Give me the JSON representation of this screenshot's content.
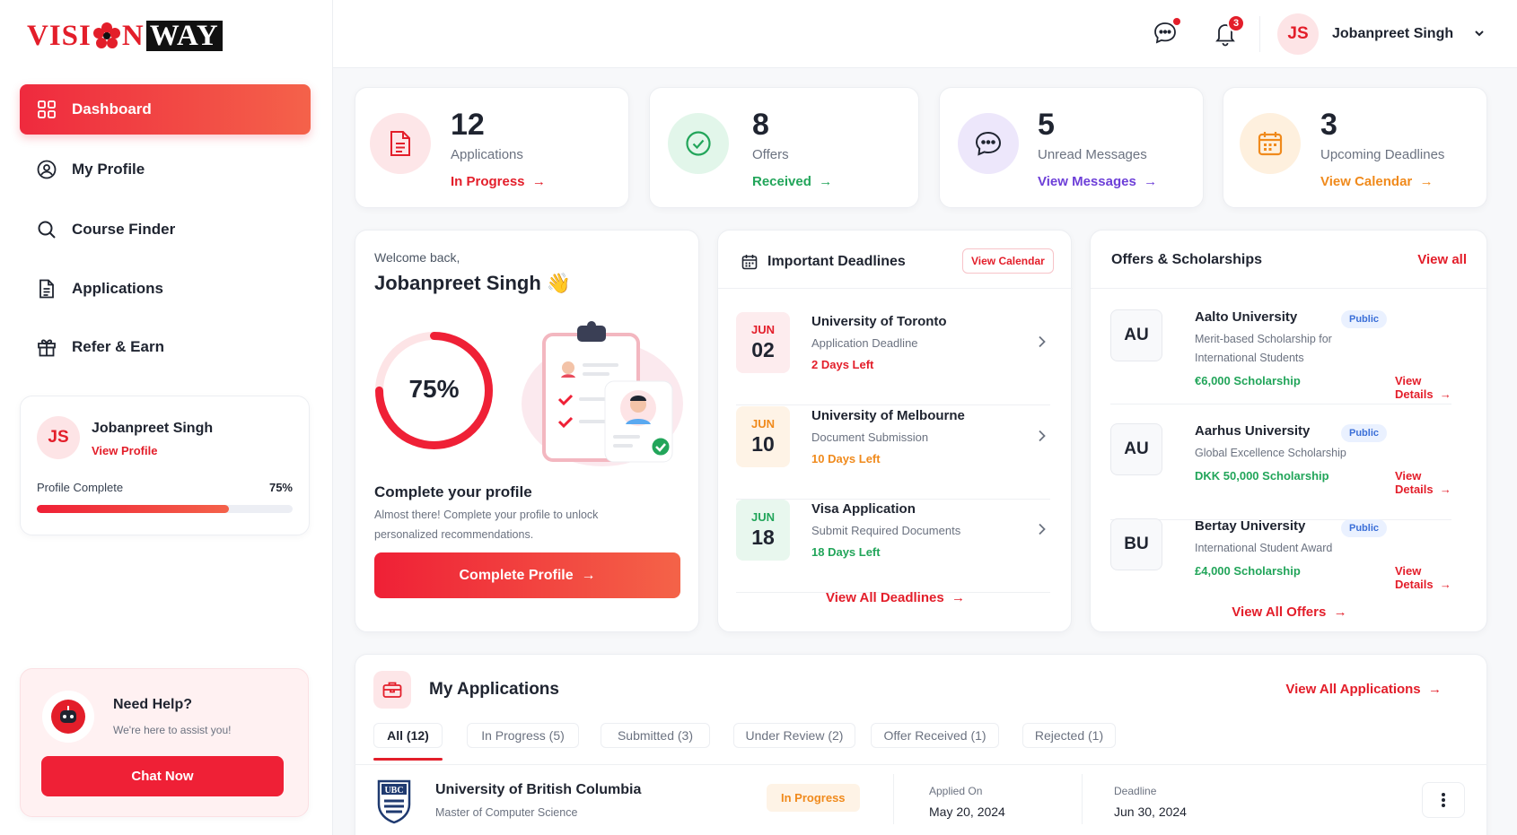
{
  "brand": {
    "logo_left": "VISI",
    "logo_right": "N",
    "logo_box": "WAY",
    "primary": "#e31e2a"
  },
  "sidebar": {
    "items": [
      {
        "label": "Dashboard",
        "icon": "grid-icon"
      },
      {
        "label": "My Profile",
        "icon": "user-circle-icon"
      },
      {
        "label": "Course Finder",
        "icon": "search-icon"
      },
      {
        "label": "Applications",
        "icon": "document-icon"
      },
      {
        "label": "Refer & Earn",
        "icon": "gift-icon"
      }
    ],
    "profile": {
      "initials": "JS",
      "name": "Jobanpreet Singh",
      "link": "View Profile",
      "progress_label": "Profile Complete",
      "progress_value": "75%",
      "progress": 0.75
    },
    "help": {
      "title": "Need Help?",
      "subtitle": "We're here to assist you!",
      "button": "Chat Now"
    }
  },
  "header": {
    "notifications": "3",
    "user_initials": "JS",
    "user_name": "Jobanpreet Singh"
  },
  "stats": [
    {
      "value": "12",
      "label": "Applications",
      "link": "In Progress",
      "color": "#e31e2a"
    },
    {
      "value": "8",
      "label": "Offers",
      "link": "Received",
      "color": "#22a55a"
    },
    {
      "value": "5",
      "label": "Unread Messages",
      "link": "View Messages",
      "color": "#6d3fd8"
    },
    {
      "value": "3",
      "label": "Upcoming Deadlines",
      "link": "View Calendar",
      "color": "#f08a1c"
    }
  ],
  "welcome": {
    "greeting": "Welcome back,",
    "name": "Jobanpreet Singh",
    "wave": "👋",
    "percent": "75%",
    "progress": 0.75,
    "title": "Complete your profile",
    "desc1": "Almost there! Complete your profile to unlock",
    "desc2": "personalized recommendations.",
    "button": "Complete Profile"
  },
  "deadlines": {
    "title": "Important Deadlines",
    "action": "View Calendar",
    "items": [
      {
        "month": "JUN",
        "day": "02",
        "uni": "University of Toronto",
        "task": "Application Deadline",
        "left": "2 Days Left",
        "color": "#e31e2a",
        "bg": "#fdecee"
      },
      {
        "month": "JUN",
        "day": "10",
        "uni": "University of Melbourne",
        "task": "Document Submission",
        "left": "10 Days Left",
        "color": "#f08a1c",
        "bg": "#fef3e6"
      },
      {
        "month": "JUN",
        "day": "18",
        "uni": "Visa Application",
        "task": "Submit Required Documents",
        "left": "18 Days Left",
        "color": "#22a55a",
        "bg": "#e8f7ee"
      }
    ],
    "footer": "View All Deadlines"
  },
  "offers": {
    "title": "Offers & Scholarships",
    "action": "View all",
    "items": [
      {
        "abbr": "AU",
        "name": "Aalto University",
        "tag": "Public",
        "desc1": "Merit-based Scholarship for",
        "desc2": "International Students",
        "amount": "€6,000 Scholarship",
        "link": "View Details"
      },
      {
        "abbr": "AU",
        "name": "Aarhus University",
        "tag": "Public",
        "desc1": "Global Excellence Scholarship",
        "desc2": "",
        "amount": "DKK 50,000 Scholarship",
        "link": "View Details"
      },
      {
        "abbr": "BU",
        "name": "Bertay University",
        "tag": "Public",
        "desc1": "International Student Award",
        "desc2": "",
        "amount": "£4,000 Scholarship",
        "link": "View Details"
      }
    ],
    "footer": "View All Offers"
  },
  "applications": {
    "title": "My Applications",
    "action": "View All Applications",
    "tabs": [
      "All  (12)",
      "In Progress  (5)",
      "Submitted  (3)",
      "Under Review (2)",
      "Offer Received (1)",
      "Rejected  (1)"
    ],
    "row": {
      "logo": "UBC",
      "uni": "University of British Columbia",
      "program": "Master of Computer Science",
      "status": "In Progress",
      "applied_label": "Applied On",
      "applied": "May 20, 2024",
      "deadline_label": "Deadline",
      "deadline": "Jun 30, 2024"
    }
  }
}
